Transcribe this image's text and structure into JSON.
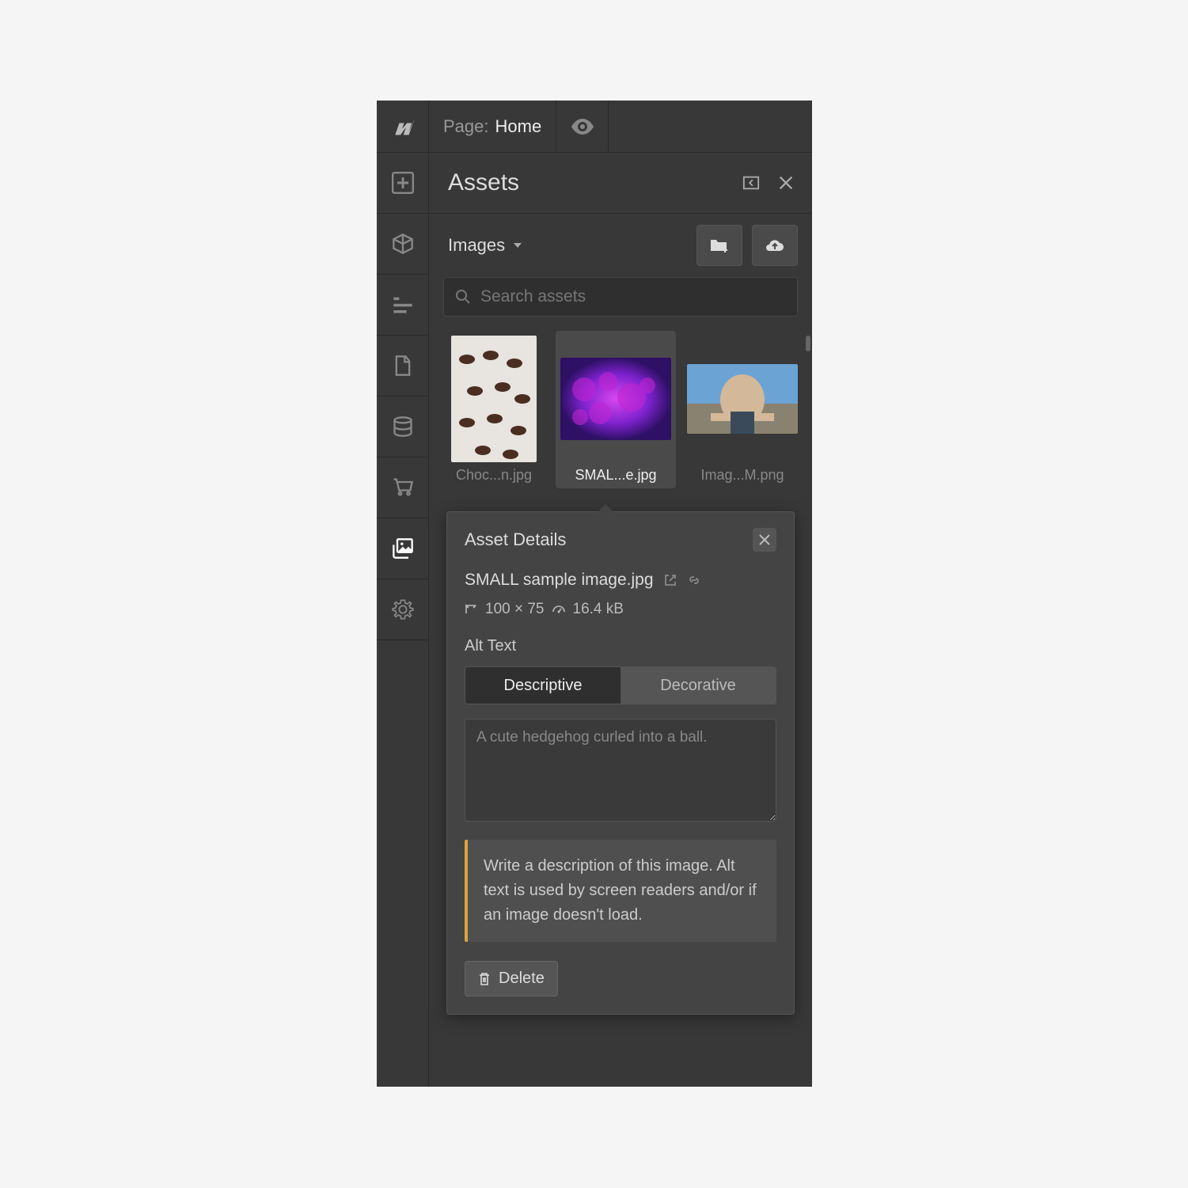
{
  "topbar": {
    "page_label": "Page:",
    "page_name": "Home"
  },
  "panel": {
    "title": "Assets",
    "filter_label": "Images",
    "search_placeholder": "Search assets"
  },
  "assets": [
    {
      "label": "Choc...n.jpg",
      "selected": false
    },
    {
      "label": "SMAL...e.jpg",
      "selected": true
    },
    {
      "label": "Imag...M.png",
      "selected": false
    }
  ],
  "details": {
    "title": "Asset Details",
    "filename": "SMALL sample image.jpg",
    "dimensions": "100 × 75",
    "filesize": "16.4 kB",
    "alt_label": "Alt Text",
    "toggle": {
      "descriptive": "Descriptive",
      "decorative": "Decorative"
    },
    "alt_placeholder": "A cute hedgehog curled into a ball.",
    "alt_value": "",
    "hint": "Write a description of this image. Alt text is used by screen readers and/or if an image doesn't load.",
    "delete_label": "Delete"
  }
}
